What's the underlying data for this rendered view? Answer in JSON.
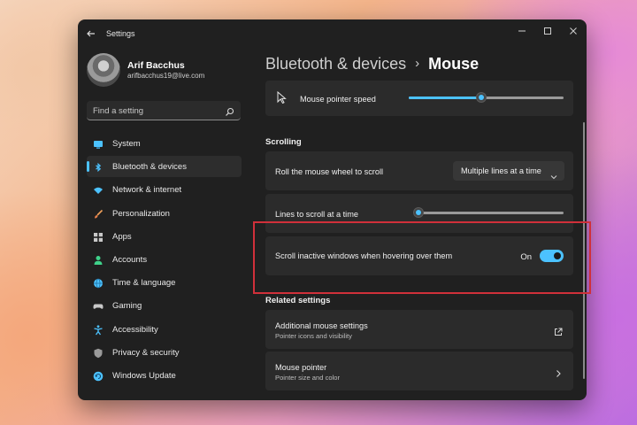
{
  "window": {
    "title": "Settings"
  },
  "user": {
    "name": "Arif Bacchus",
    "email": "arifbacchus19@live.com"
  },
  "search": {
    "placeholder": "Find a setting",
    "icon": "search-icon"
  },
  "sidebar": {
    "items": [
      {
        "label": "System",
        "icon": "monitor-icon",
        "color": "#4cc2ff",
        "active": false
      },
      {
        "label": "Bluetooth & devices",
        "icon": "bluetooth-icon",
        "color": "#4cc2ff",
        "active": true
      },
      {
        "label": "Network & internet",
        "icon": "wifi-icon",
        "color": "#4cc2ff",
        "active": false
      },
      {
        "label": "Personalization",
        "icon": "brush-icon",
        "color": "#f0a05a",
        "active": false
      },
      {
        "label": "Apps",
        "icon": "apps-icon",
        "color": "#c8c8c8",
        "active": false
      },
      {
        "label": "Accounts",
        "icon": "person-icon",
        "color": "#3fd28a",
        "active": false
      },
      {
        "label": "Time & language",
        "icon": "globe-icon",
        "color": "#4cc2ff",
        "active": false
      },
      {
        "label": "Gaming",
        "icon": "gamepad-icon",
        "color": "#c8c8c8",
        "active": false
      },
      {
        "label": "Accessibility",
        "icon": "accessibility-icon",
        "color": "#4cc2ff",
        "active": false
      },
      {
        "label": "Privacy & security",
        "icon": "shield-icon",
        "color": "#9a9a9a",
        "active": false
      },
      {
        "label": "Windows Update",
        "icon": "update-icon",
        "color": "#4cc2ff",
        "active": false
      }
    ]
  },
  "breadcrumb": {
    "parent": "Bluetooth & devices",
    "separator": "›",
    "current": "Mouse"
  },
  "pointer_speed": {
    "label": "Mouse pointer speed",
    "value_fraction": 0.47
  },
  "scrolling": {
    "heading": "Scrolling",
    "wheel": {
      "label": "Roll the mouse wheel to scroll",
      "value": "Multiple lines at a time"
    },
    "lines": {
      "label": "Lines to scroll at a time",
      "value_fraction": 0.03
    },
    "inactive": {
      "label": "Scroll inactive windows when hovering over them",
      "state": "On"
    }
  },
  "related": {
    "heading": "Related settings",
    "items": [
      {
        "title": "Additional mouse settings",
        "subtitle": "Pointer icons and visibility",
        "icon": "external-link-icon"
      },
      {
        "title": "Mouse pointer",
        "subtitle": "Pointer size and color",
        "icon": "chevron-right-icon"
      }
    ]
  },
  "colors": {
    "accent": "#4cc2ff",
    "highlight_box": "#d0303a",
    "window_bg": "#202020",
    "card_bg": "#2b2b2b"
  }
}
